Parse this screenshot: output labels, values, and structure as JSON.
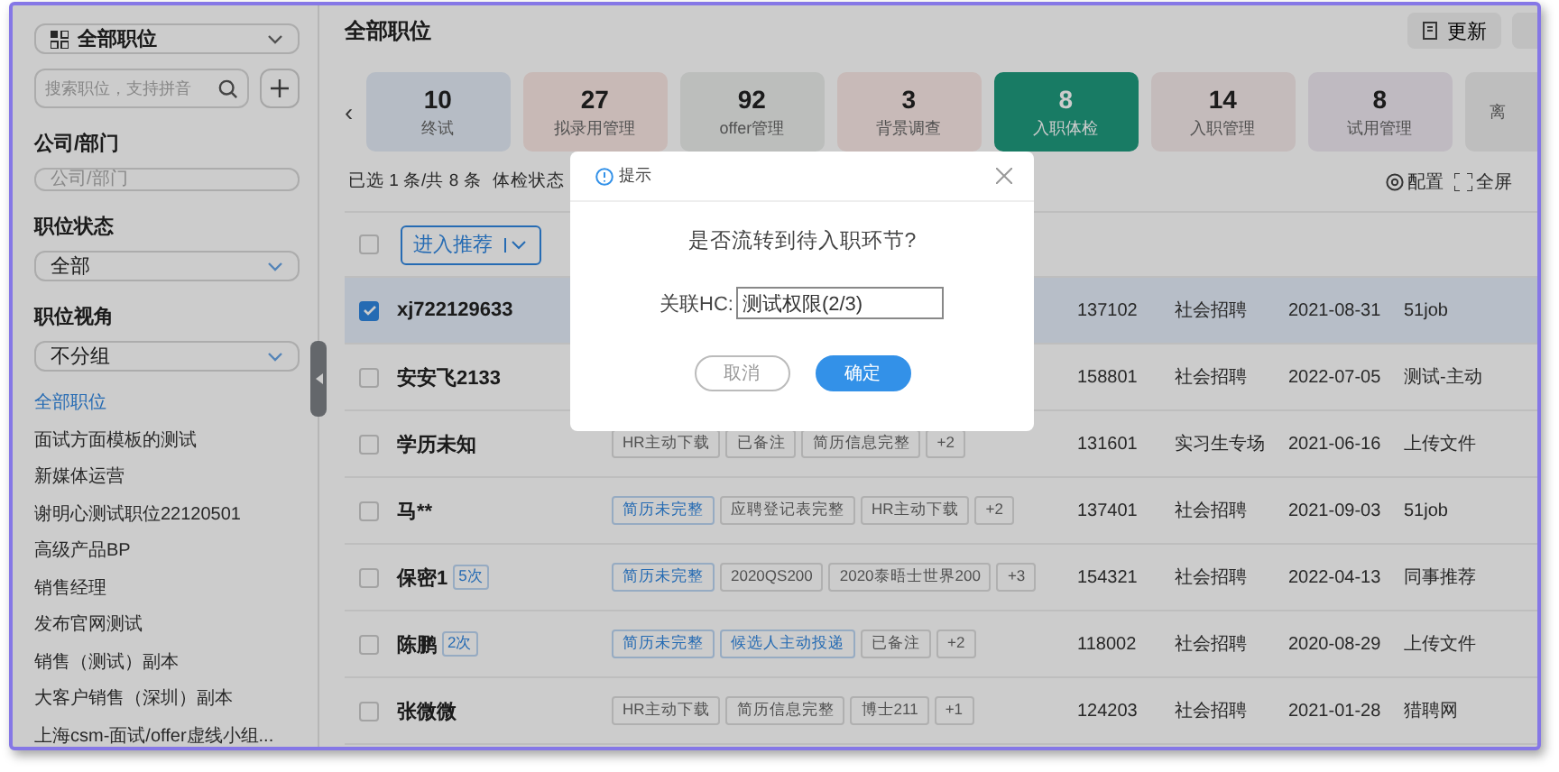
{
  "sidebar": {
    "view_select": "全部职位",
    "search": {
      "placeholder": "搜索职位，支持拼音"
    },
    "filters": [
      {
        "label": "公司/部门",
        "kind": "input",
        "placeholder": "公司/部门"
      },
      {
        "label": "职位状态",
        "kind": "select",
        "value": "全部"
      },
      {
        "label": "职位视角",
        "kind": "select",
        "value": "不分组"
      }
    ],
    "jobs": [
      {
        "label": "全部职位",
        "selected": true
      },
      {
        "label": "面试方面模板的测试",
        "selected": false
      },
      {
        "label": "新媒体运营",
        "selected": false
      },
      {
        "label": "谢明心测试职位22120501",
        "selected": false
      },
      {
        "label": "高级产品BP",
        "selected": false
      },
      {
        "label": "销售经理",
        "selected": false
      },
      {
        "label": "发布官网测试",
        "selected": false
      },
      {
        "label": "销售（测试）副本",
        "selected": false
      },
      {
        "label": "大客户销售（深圳）副本",
        "selected": false
      },
      {
        "label": "上海csm-面试/offer虚线小组...",
        "selected": false
      }
    ]
  },
  "header": {
    "title": "全部职位",
    "update_button": "更新"
  },
  "stage_prev": "‹",
  "stages": [
    {
      "count": "10",
      "label": "终试",
      "selected": false
    },
    {
      "count": "27",
      "label": "拟录用管理",
      "selected": false
    },
    {
      "count": "92",
      "label": "offer管理",
      "selected": false
    },
    {
      "count": "3",
      "label": "背景调查",
      "selected": false
    },
    {
      "count": "8",
      "label": "入职体检",
      "selected": true
    },
    {
      "count": "14",
      "label": "入职管理",
      "selected": false
    },
    {
      "count": "8",
      "label": "试用管理",
      "selected": false
    },
    {
      "label": "离",
      "selected": false
    }
  ],
  "summary": {
    "selection": "已选 1 条/共 8 条",
    "filter_label": "体检状态"
  },
  "actions": [
    {
      "kind": "config",
      "label": "配置"
    },
    {
      "kind": "fullscreen",
      "label": "全屏"
    }
  ],
  "toolbar": {
    "all_checked": false,
    "recommend_button": "进入推荐"
  },
  "rows": [
    {
      "name": "xj722129633",
      "checked": true,
      "selected": true,
      "tags": [],
      "id": "137102",
      "type": "社会招聘",
      "date": "2021-08-31",
      "source": "51job"
    },
    {
      "name": "安安飞2133",
      "checked": false,
      "selected": false,
      "tags": [],
      "id": "158801",
      "type": "社会招聘",
      "date": "2022-07-05",
      "source": "测试-主动"
    },
    {
      "name": "学历未知",
      "checked": false,
      "selected": false,
      "tags": [
        {
          "label": "HR主动下载",
          "kind": "plain"
        },
        {
          "label": "已备注",
          "kind": "plain"
        },
        {
          "label": "简历信息完整",
          "kind": "plain"
        },
        {
          "label": "+2",
          "kind": "plain"
        }
      ],
      "id": "131601",
      "type": "实习生专场",
      "date": "2021-06-16",
      "source": "上传文件"
    },
    {
      "name": "马**",
      "checked": false,
      "selected": false,
      "tags": [
        {
          "label": "简历未完整",
          "kind": "highlight"
        },
        {
          "label": "应聘登记表完整",
          "kind": "plain"
        },
        {
          "label": "HR主动下载",
          "kind": "plain"
        },
        {
          "label": "+2",
          "kind": "plain"
        }
      ],
      "id": "137401",
      "type": "社会招聘",
      "date": "2021-09-03",
      "source": "51job"
    },
    {
      "name": "保密1",
      "badge": "5次",
      "checked": false,
      "selected": false,
      "tags": [
        {
          "label": "简历未完整",
          "kind": "highlight"
        },
        {
          "label": "2020QS200",
          "kind": "plain"
        },
        {
          "label": "2020泰晤士世界200",
          "kind": "plain"
        },
        {
          "label": "+3",
          "kind": "plain"
        }
      ],
      "id": "154321",
      "type": "社会招聘",
      "date": "2022-04-13",
      "source": "同事推荐"
    },
    {
      "name": "陈鹏",
      "badge": "2次",
      "checked": false,
      "selected": false,
      "tags": [
        {
          "label": "简历未完整",
          "kind": "highlight"
        },
        {
          "label": "候选人主动投递",
          "kind": "highlight"
        },
        {
          "label": "已备注",
          "kind": "plain"
        },
        {
          "label": "+2",
          "kind": "plain"
        }
      ],
      "id": "118002",
      "type": "社会招聘",
      "date": "2020-08-29",
      "source": "上传文件"
    },
    {
      "name": "张微微",
      "checked": false,
      "selected": false,
      "tags": [
        {
          "label": "HR主动下载",
          "kind": "plain"
        },
        {
          "label": "简历信息完整",
          "kind": "plain"
        },
        {
          "label": "博士211",
          "kind": "plain"
        },
        {
          "label": "+1",
          "kind": "plain"
        }
      ],
      "id": "124203",
      "type": "社会招聘",
      "date": "2021-01-28",
      "source": "猎聘网"
    }
  ],
  "dialog": {
    "title": "提示",
    "message": "是否流转到待入职环节?",
    "field_label": "关联HC:",
    "field_value": "测试权限(2/3)",
    "cancel": "取消",
    "confirm": "确定"
  }
}
